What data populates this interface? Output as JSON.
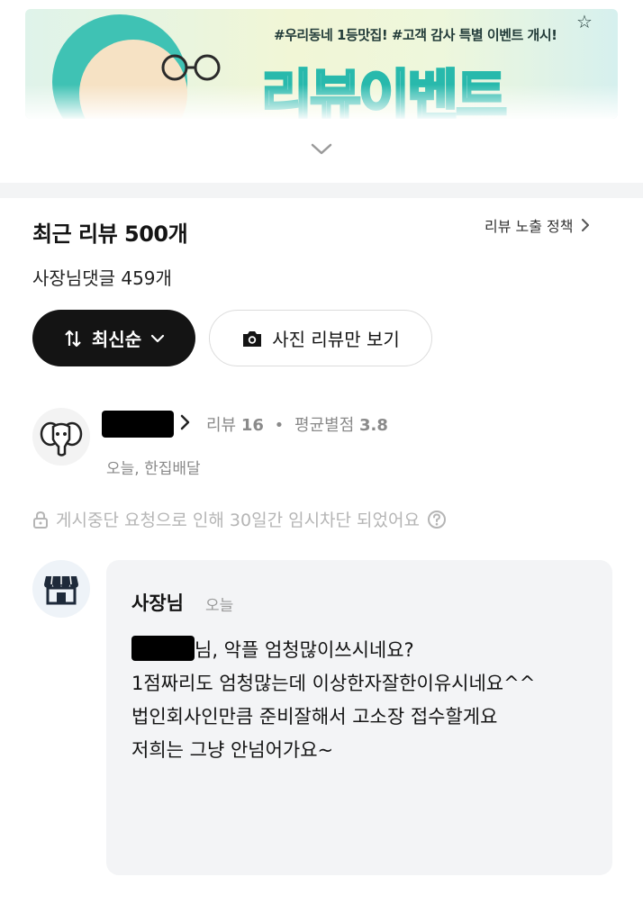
{
  "banner": {
    "subtitle": "#우리동네 1등맛집! #고객 감사 특별 이벤트 개시!",
    "title": "리뷰이벤트"
  },
  "reviews_header": {
    "title": "최근 리뷰 500개",
    "policy_link": "리뷰 노출 정책",
    "owner_comments": "사장님댓글 459개"
  },
  "filters": {
    "sort_label": "최신순",
    "photo_only_label": "사진 리뷰만 보기"
  },
  "review": {
    "stats_label": "리뷰",
    "review_count": "16",
    "avg_label": "평균별점",
    "avg_rating": "3.8",
    "meta": "오늘, 한집배달",
    "notice": "게시중단 요청으로 인해 30일간 임시차단 되었어요"
  },
  "owner_reply": {
    "author": "사장님",
    "time": "오늘",
    "line1_suffix": "님, 악플 엄청많이쓰시네요?",
    "line2": "1점짜리도 엄청많는데 이상한자잘한이유시네요^^",
    "line3": "법인회사인만큼 준비잘해서 고소장 접수할게요",
    "line4": "저희는 그냥 안넘어가요~"
  },
  "colors": {
    "accent_dark": "#141414",
    "muted": "#8a8a8a",
    "reply_bg": "#f3f4f6",
    "banner_teal": "#28b9ac"
  }
}
